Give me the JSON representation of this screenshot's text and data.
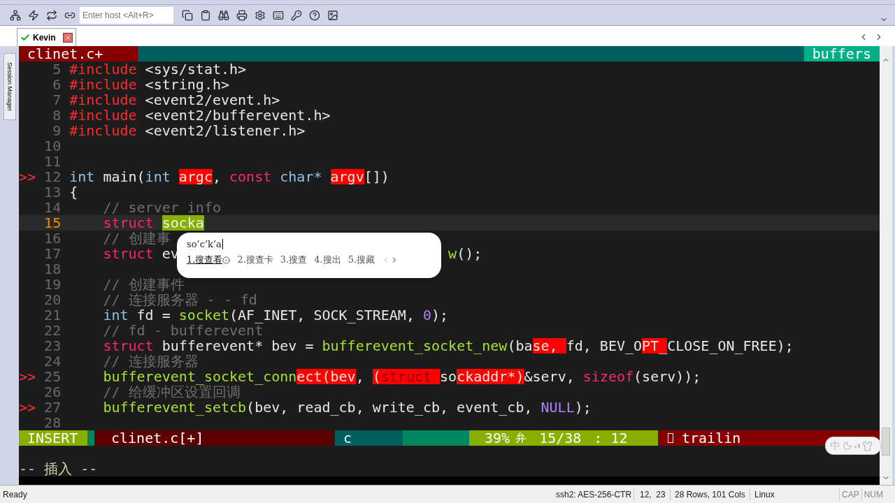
{
  "toolbar": {
    "host_field": {
      "placeholder": "Enter host <Alt+R>"
    }
  },
  "tabs": [
    {
      "label": "Kevin",
      "selected": true,
      "connected": true
    }
  ],
  "sidebar": {
    "label": "Session Manager"
  },
  "vim": {
    "tabline": {
      "file": "clinet.c+",
      "right_label": "buffers"
    },
    "lines": [
      {
        "number": "5",
        "tokens": [
          {
            "kind": "pre",
            "text": "#include"
          },
          {
            "kind": "plain",
            "text": " <sys/stat.h>"
          }
        ]
      },
      {
        "number": "6",
        "tokens": [
          {
            "kind": "pre",
            "text": "#include"
          },
          {
            "kind": "plain",
            "text": " <string.h>"
          }
        ]
      },
      {
        "number": "7",
        "tokens": [
          {
            "kind": "pre",
            "text": "#include"
          },
          {
            "kind": "plain",
            "text": " <event2/event.h>"
          }
        ]
      },
      {
        "number": "8",
        "tokens": [
          {
            "kind": "pre",
            "text": "#include"
          },
          {
            "kind": "plain",
            "text": " <event2/bufferevent.h>"
          }
        ]
      },
      {
        "number": "9",
        "tokens": [
          {
            "kind": "pre",
            "text": "#include"
          },
          {
            "kind": "plain",
            "text": " <event2/listener.h>"
          }
        ]
      },
      {
        "number": "10"
      },
      {
        "number": "11"
      },
      {
        "number": "12",
        "sign": ">>",
        "tokens": [
          {
            "kind": "type",
            "text": "int"
          },
          {
            "kind": "plain",
            "text": " main("
          },
          {
            "kind": "type",
            "text": "int "
          },
          {
            "kind": "error",
            "text": "argc"
          },
          {
            "kind": "plain",
            "text": ", "
          },
          {
            "kind": "keyword",
            "text": "const "
          },
          {
            "kind": "type",
            "text": "char* "
          },
          {
            "kind": "error",
            "text": "argv"
          },
          {
            "kind": "plain",
            "text": "[])"
          }
        ]
      },
      {
        "number": "13",
        "tokens": [
          {
            "kind": "plain",
            "text": "{"
          }
        ]
      },
      {
        "number": "14",
        "indent": true,
        "tokens": [
          {
            "kind": "comment",
            "text": "// server info"
          }
        ]
      },
      {
        "number": "15",
        "current": true,
        "indent": true,
        "tokens": [
          {
            "kind": "keyword",
            "text": "struct "
          },
          {
            "kind": "match",
            "text": "socka"
          }
        ]
      },
      {
        "number": "16",
        "indent": true,
        "tokens": [
          {
            "kind": "comment",
            "text": "// 创建事"
          }
        ]
      },
      {
        "number": "17",
        "indent": true,
        "tokens": [
          {
            "kind": "keyword",
            "text": "struct"
          },
          {
            "kind": "plain",
            "text": " ev"
          }
        ],
        "tail": [
          {
            "kind": "func",
            "text": "w"
          },
          {
            "kind": "plain",
            "text": "();"
          }
        ]
      },
      {
        "number": "18"
      },
      {
        "number": "19",
        "indent": true,
        "tokens": [
          {
            "kind": "comment",
            "text": "// 创建事件"
          }
        ]
      },
      {
        "number": "20",
        "indent": true,
        "tokens": [
          {
            "kind": "comment",
            "text": "// 连接服务器 - - fd"
          }
        ]
      },
      {
        "number": "21",
        "indent": true,
        "tokens": [
          {
            "kind": "type",
            "text": "int"
          },
          {
            "kind": "plain",
            "text": " fd = "
          },
          {
            "kind": "func",
            "text": "socket"
          },
          {
            "kind": "plain",
            "text": "(AF_INET, SOCK_STREAM, "
          },
          {
            "kind": "number",
            "text": "0"
          },
          {
            "kind": "plain",
            "text": ");"
          }
        ]
      },
      {
        "number": "22",
        "indent": true,
        "tokens": [
          {
            "kind": "comment",
            "text": "// fd - bufferevent"
          }
        ]
      },
      {
        "number": "23",
        "indent": true,
        "tokens": [
          {
            "kind": "keyword",
            "text": "struct"
          },
          {
            "kind": "plain",
            "text": " bufferevent* bev = "
          },
          {
            "kind": "func",
            "text": "bufferevent_socket_new"
          },
          {
            "kind": "plain",
            "text": "(ba"
          },
          {
            "kind": "error",
            "text": "se, "
          },
          {
            "kind": "plain",
            "text": "fd, BEV_O"
          },
          {
            "kind": "error",
            "text": "PT_"
          },
          {
            "kind": "plain",
            "text": "CLOSE_ON_FREE);"
          }
        ]
      },
      {
        "number": "24",
        "indent": true,
        "tokens": [
          {
            "kind": "comment",
            "text": "// 连接服务器"
          }
        ]
      },
      {
        "number": "25",
        "sign": ">>",
        "indent": true,
        "tokens": [
          {
            "kind": "func",
            "text": "bufferevent_socket_conn"
          },
          {
            "kind": "error",
            "text": "ect(bev"
          },
          {
            "kind": "plain",
            "text": ", "
          },
          {
            "kind": "error",
            "text": "("
          },
          {
            "kind": "error_keyword",
            "text": "struct "
          },
          {
            "kind": "plain",
            "text": "so"
          },
          {
            "kind": "error",
            "text": "ckaddr*)"
          },
          {
            "kind": "plain",
            "text": "&serv, "
          },
          {
            "kind": "keyword",
            "text": "sizeof"
          },
          {
            "kind": "plain",
            "text": "(serv));"
          }
        ]
      },
      {
        "number": "26",
        "indent": true,
        "tokens": [
          {
            "kind": "comment",
            "text": "// 给缓冲区设置回调"
          }
        ]
      },
      {
        "number": "27",
        "sign": ">>",
        "indent": true,
        "tokens": [
          {
            "kind": "func",
            "text": "bufferevent_setcb"
          },
          {
            "kind": "plain",
            "text": "(bev, read_cb, write_cb, event_cb, "
          },
          {
            "kind": "number",
            "text": "NULL"
          },
          {
            "kind": "plain",
            "text": ");"
          }
        ]
      },
      {
        "number": "28"
      }
    ],
    "statusline": {
      "mode": "INSERT",
      "file": "clinet.c[+]",
      "filetype": "c",
      "percent": "39%",
      "glyph": "弁",
      "position": "15/38",
      "separator": ":",
      "column": "12",
      "warning": "trailin"
    },
    "command_line": "-- 插入 --"
  },
  "ime_popup": {
    "input": "so’c’k’a",
    "candidates": [
      {
        "text": "1.搜查看",
        "selected": true
      },
      {
        "text": "2.搜查卡",
        "selected": false
      },
      {
        "text": "3.搜查",
        "selected": false
      },
      {
        "text": "4.搜出",
        "selected": false
      },
      {
        "text": "5.搜藏",
        "selected": false
      }
    ]
  },
  "ime_toolbar": {
    "label": "中"
  },
  "status_bar": {
    "state": "Ready",
    "cipher": "ssh2: AES-256-CTR",
    "cursor": "12,  23",
    "size": "28 Rows, 101 Cols",
    "os": "Linux",
    "caps": "CAP",
    "num": "NUM"
  }
}
